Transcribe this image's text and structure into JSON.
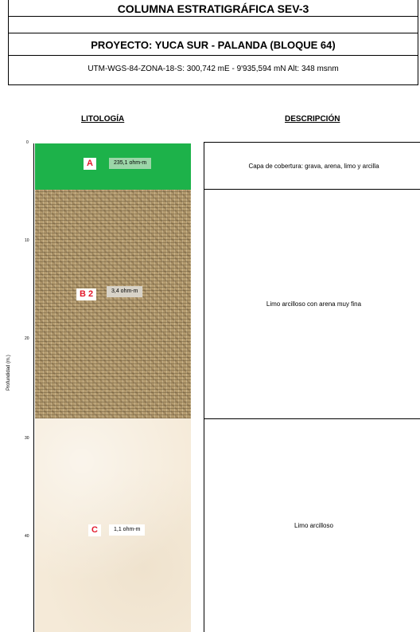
{
  "header": {
    "title": "COLUMNA ESTRATIGRÁFICA SEV-3",
    "project": "PROYECTO: YUCA SUR - PALANDA (BLOQUE 64)",
    "coords": "UTM-WGS-84-ZONA-18-S: 300,742 mE - 9'935,594 mN  Alt: 348 msnm"
  },
  "columns": {
    "lithology": "LITOLOGÍA",
    "description": "DESCRIPCIÓN"
  },
  "axis": {
    "label": "Profundidad (m.)",
    "ticks": [
      "0",
      "10",
      "20",
      "30",
      "40"
    ]
  },
  "layers": [
    {
      "id": "A",
      "resistivity": "235,1 ohm-m",
      "description": "Capa de cobertura: grava, arena, limo y arcilla",
      "color": "#1db24a"
    },
    {
      "id": "B 2",
      "resistivity": "3,4 ohm-m",
      "description": "Limo arcilloso con arena muy fina",
      "color": "#b39a6e"
    },
    {
      "id": "C",
      "resistivity": "1,1 ohm-m",
      "description": "Limo arcilloso",
      "color": "#f5ead8"
    }
  ]
}
